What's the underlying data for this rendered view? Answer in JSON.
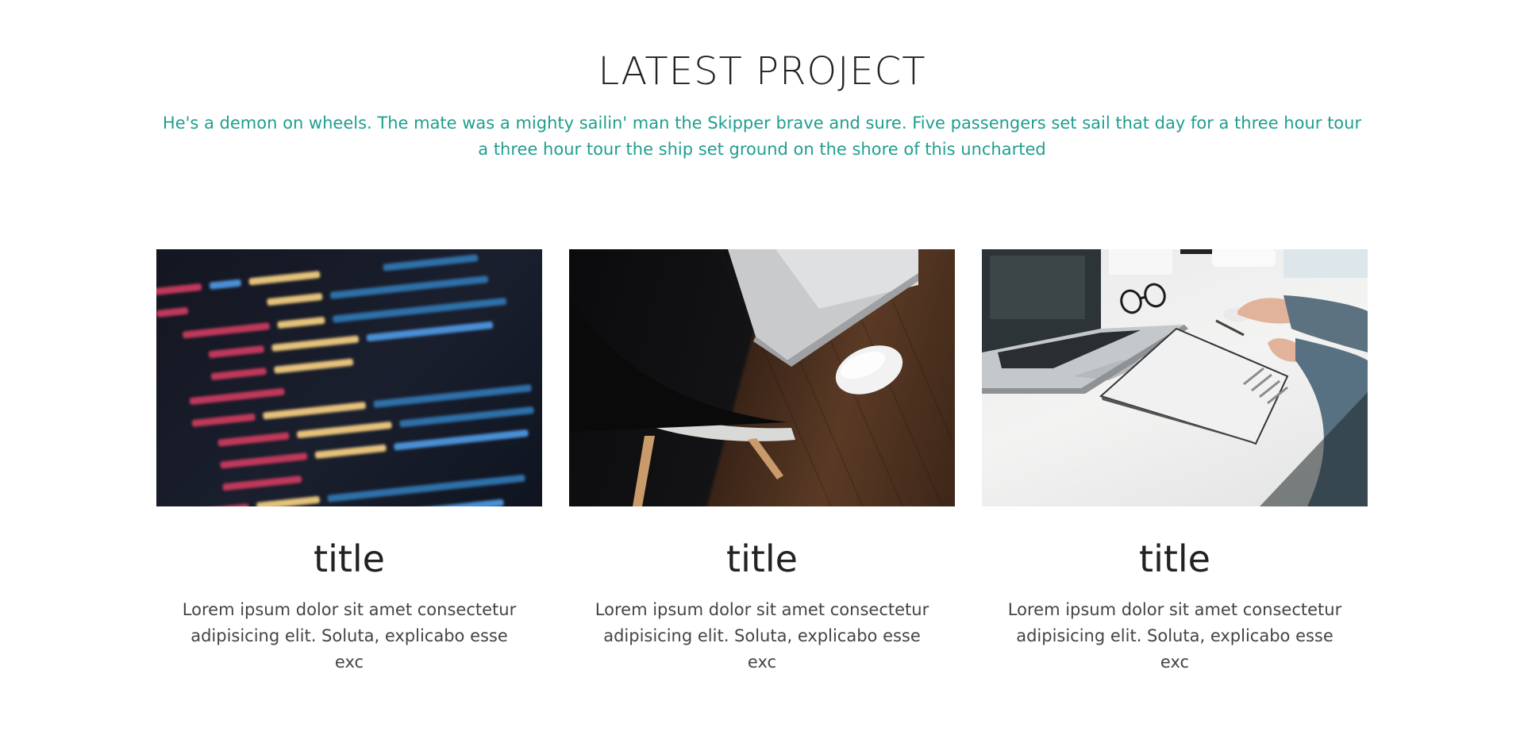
{
  "section": {
    "title": "LATEST PROJECT",
    "subtitle": "He's a demon on wheels. The mate was a mighty sailin' man the Skipper brave and sure. Five passengers set sail that day for a three hour tour a three hour tour the ship set ground on the shore of this uncharted"
  },
  "colors": {
    "accent": "#1f9e8f",
    "heading": "#222222",
    "body_text": "#444444"
  },
  "projects": [
    {
      "image": "code-on-screen-photo",
      "title": "title",
      "text": "Lorem ipsum dolor sit amet consectetur adipisicing elit. Soluta, explicabo esse exc"
    },
    {
      "image": "desk-laptop-chair-photo",
      "title": "title",
      "text": "Lorem ipsum dolor sit amet consectetur adipisicing elit. Soluta, explicabo esse exc"
    },
    {
      "image": "white-desk-laptop-notebook-photo",
      "title": "title",
      "text": "Lorem ipsum dolor sit amet consectetur adipisicing elit. Soluta, explicabo esse exc"
    }
  ]
}
